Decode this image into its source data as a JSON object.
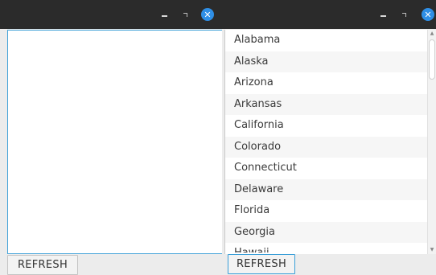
{
  "left_window": {
    "refresh_label": "REFRESH",
    "titlebar": {
      "minimize": "minimize",
      "restore": "restore",
      "close_glyph": "✕"
    }
  },
  "right_window": {
    "refresh_label": "REFRESH",
    "titlebar": {
      "minimize": "minimize",
      "restore": "restore",
      "close_glyph": "✕"
    },
    "states": [
      "Alabama",
      "Alaska",
      "Arizona",
      "Arkansas",
      "California",
      "Colorado",
      "Connecticut",
      "Delaware",
      "Florida",
      "Georgia",
      "Hawaii"
    ],
    "scroll_up_glyph": "▲",
    "scroll_down_glyph": "▼"
  },
  "colors": {
    "titlebar": "#2b2b2b",
    "accent": "#2f8fe6",
    "focus_border": "#44a3d9",
    "background": "#ececec"
  }
}
